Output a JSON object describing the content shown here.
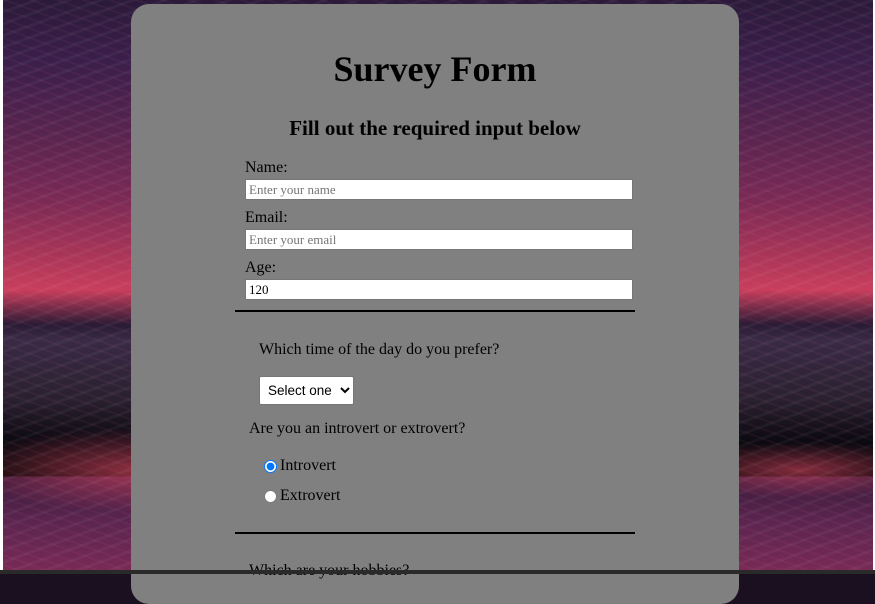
{
  "form": {
    "title": "Survey Form",
    "subtitle": "Fill out the required input below",
    "name": {
      "label": "Name:",
      "placeholder": "Enter your name",
      "value": ""
    },
    "email": {
      "label": "Email:",
      "placeholder": "Enter your email",
      "value": ""
    },
    "age": {
      "label": "Age:",
      "value": "120"
    },
    "time_question": "Which time of the day do you prefer?",
    "time_select": {
      "selected": "Select one"
    },
    "personality_question": "Are you an introvert or extrovert?",
    "radios": [
      {
        "label": "Introvert",
        "checked": true
      },
      {
        "label": "Extrovert",
        "checked": false
      }
    ],
    "next_question_partial": "Which are your hobbies?"
  }
}
